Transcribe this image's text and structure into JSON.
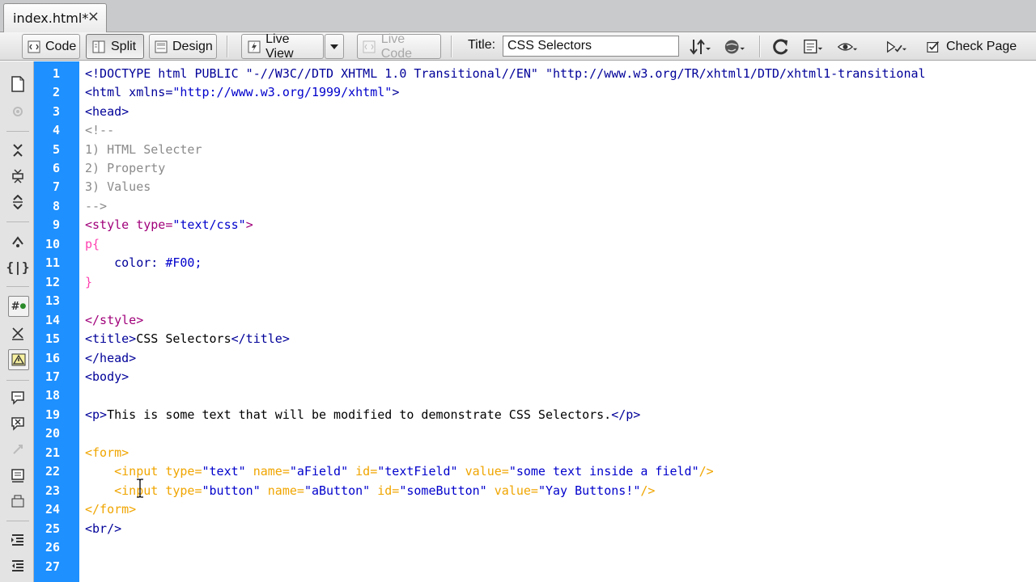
{
  "tab": {
    "label": "index.html*",
    "close": "×"
  },
  "toolbar": {
    "code_label": "Code",
    "split_label": "Split",
    "design_label": "Design",
    "live_view_label": "Live View",
    "live_code_label": "Live Code",
    "title_label": "Title:",
    "title_value": "CSS Selectors",
    "check_page_label": "Check Page"
  },
  "line_numbers": [
    "1",
    "2",
    "3",
    "4",
    "5",
    "6",
    "7",
    "8",
    "9",
    "10",
    "11",
    "12",
    "13",
    "14",
    "15",
    "16",
    "17",
    "18",
    "19",
    "20",
    "21",
    "22",
    "23",
    "24",
    "25",
    "26",
    "27"
  ],
  "code": {
    "l1": "<!DOCTYPE html PUBLIC \"-//W3C//DTD XHTML 1.0 Transitional//EN\" \"http://www.w3.org/TR/xhtml1/DTD/xhtml1-transitional",
    "l2a": "<html xmlns=",
    "l2b": "\"http://www.w3.org/1999/xhtml\"",
    "l2c": ">",
    "l3": "<head>",
    "l4": "<!--",
    "l5": "1) HTML Selecter",
    "l6": "2) Property",
    "l7": "3) Values",
    "l8": "-->",
    "l9a": "<style type=",
    "l9b": "\"text/css\"",
    "l9c": ">",
    "l10": "p{",
    "l11a": "    color: ",
    "l11b": "#F00;",
    "l12": "}",
    "l14": "</style>",
    "l15a": "<title>",
    "l15b": "CSS Selectors",
    "l15c": "</title>",
    "l16": "</head>",
    "l17": "<body>",
    "l19a": "<p>",
    "l19b": "This is some text that will be modified to demonstrate CSS Selectors.",
    "l19c": "</p>",
    "l21": "<form>",
    "l22a": "    <input type=",
    "l22b": "\"text\"",
    "l22c": " name=",
    "l22d": "\"aField\"",
    "l22e": " id=",
    "l22f": "\"textField\"",
    "l22g": " value=",
    "l22h": "\"some text inside a field\"",
    "l22i": "/>",
    "l23a": "    <input type=",
    "l23b": "\"button\"",
    "l23c": " name=",
    "l23d": "\"aButton\"",
    "l23e": " id=",
    "l23f": "\"someButton\"",
    "l23g": " value=",
    "l23h": "\"Yay Buttons!\"",
    "l23i": "/>",
    "l24": "</form>",
    "l25": "<br/>"
  },
  "colors": {
    "gutter": "#1e90ff",
    "tag": "#000099",
    "string": "#0000cc",
    "comment": "#8a8a8a",
    "style_tag": "#a0007a",
    "form_tag": "#f0a500"
  }
}
